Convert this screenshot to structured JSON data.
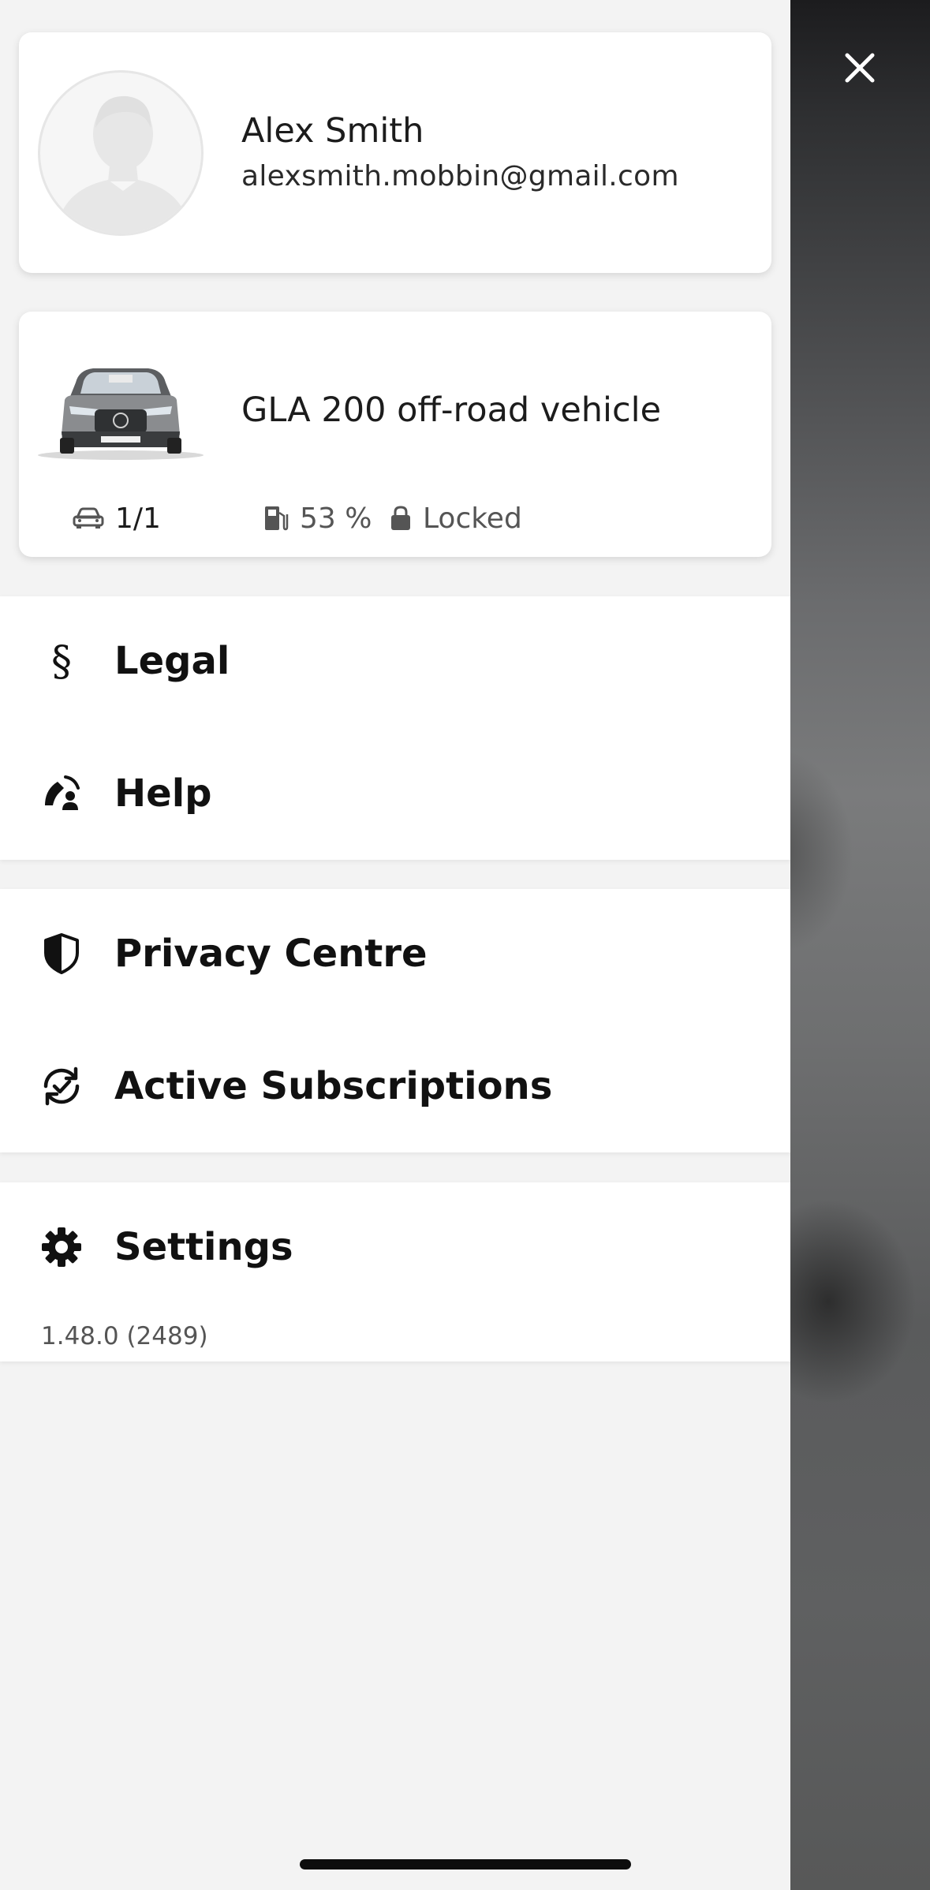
{
  "profile": {
    "name": "Alex Smith",
    "email": "alexsmith.mobbin@gmail.com"
  },
  "vehicle": {
    "name": "GLA 200 off-road vehicle",
    "count": "1/1",
    "fuel": "53 %",
    "lock_status": "Locked"
  },
  "menu": {
    "legal": "Legal",
    "help": "Help",
    "privacy": "Privacy Centre",
    "subscriptions": "Active Subscriptions",
    "settings": "Settings"
  },
  "app_version": "1.48.0 (2489)",
  "icons": {
    "close": "close-icon",
    "legal": "section-sign-icon",
    "help": "phone-support-icon",
    "privacy": "shield-icon",
    "subscriptions": "refresh-check-icon",
    "settings": "gear-icon",
    "vehicle": "car-icon",
    "fuel": "fuel-pump-icon",
    "lock": "lock-icon"
  }
}
